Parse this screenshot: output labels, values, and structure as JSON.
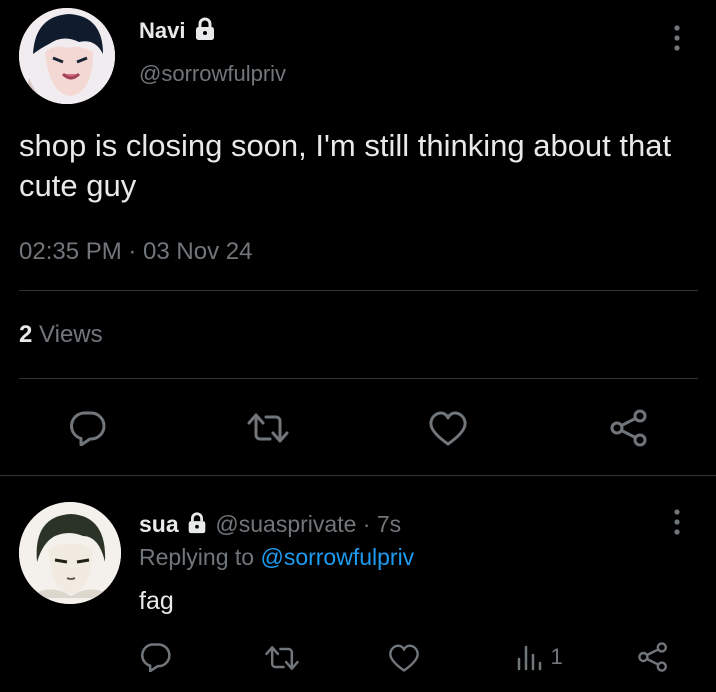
{
  "main_tweet": {
    "display_name": "Navi",
    "handle": "@sorrowfulpriv",
    "text": "shop is closing soon, I'm still thinking about that cute guy",
    "timestamp": "02:35 PM · 03 Nov 24",
    "views_count": "2",
    "views_label": "Views"
  },
  "reply": {
    "display_name": "sua",
    "handle": "@suasprivate",
    "separator": "·",
    "time": "7s",
    "replying_prefix": "Replying to",
    "replying_to": "@sorrowfulpriv",
    "text": "fag",
    "views_count": "1"
  },
  "colors": {
    "background": "#000000",
    "text": "#e7e9ea",
    "muted": "#71767b",
    "link": "#1d9bf0",
    "divider": "#2f3336"
  },
  "icons": [
    "lock-icon",
    "more-icon",
    "reply-icon",
    "retweet-icon",
    "like-icon",
    "share-icon",
    "views-icon"
  ]
}
